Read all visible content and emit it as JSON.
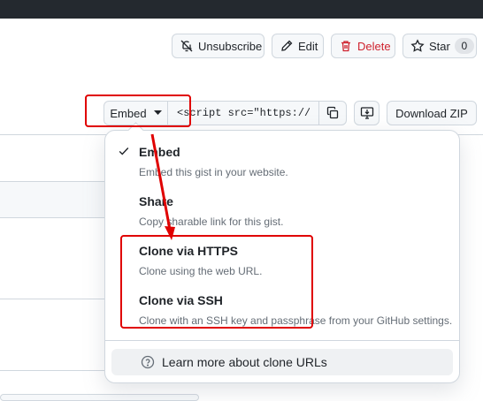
{
  "header": {
    "unsubscribe_label": "Unsubscribe",
    "edit_label": "Edit",
    "delete_label": "Delete",
    "star_label": "Star",
    "star_count": "0"
  },
  "toolbar": {
    "embed_label": "Embed",
    "embed_value": "<script src=\"https://g",
    "download_label": "Download ZIP"
  },
  "dropdown": {
    "items": [
      {
        "title": "Embed",
        "description": "Embed this gist in your website.",
        "selected": true
      },
      {
        "title": "Share",
        "description": "Copy sharable link for this gist.",
        "selected": false
      },
      {
        "title": "Clone via HTTPS",
        "description": "Clone using the web URL.",
        "selected": false
      },
      {
        "title": "Clone via SSH",
        "description": "Clone with an SSH key and passphrase from your GitHub settings.",
        "selected": false
      }
    ],
    "footer_label": "Learn more about clone URLs"
  },
  "colors": {
    "topbar": "#24292f",
    "danger": "#cf222e",
    "annotation": "#e00000",
    "muted_text": "#656d76",
    "border": "#d0d7de"
  },
  "icons": [
    "bell-slash-icon",
    "pencil-icon",
    "trash-icon",
    "star-icon",
    "triangle-down-icon",
    "copy-icon",
    "desktop-download-icon",
    "check-icon",
    "question-icon"
  ]
}
